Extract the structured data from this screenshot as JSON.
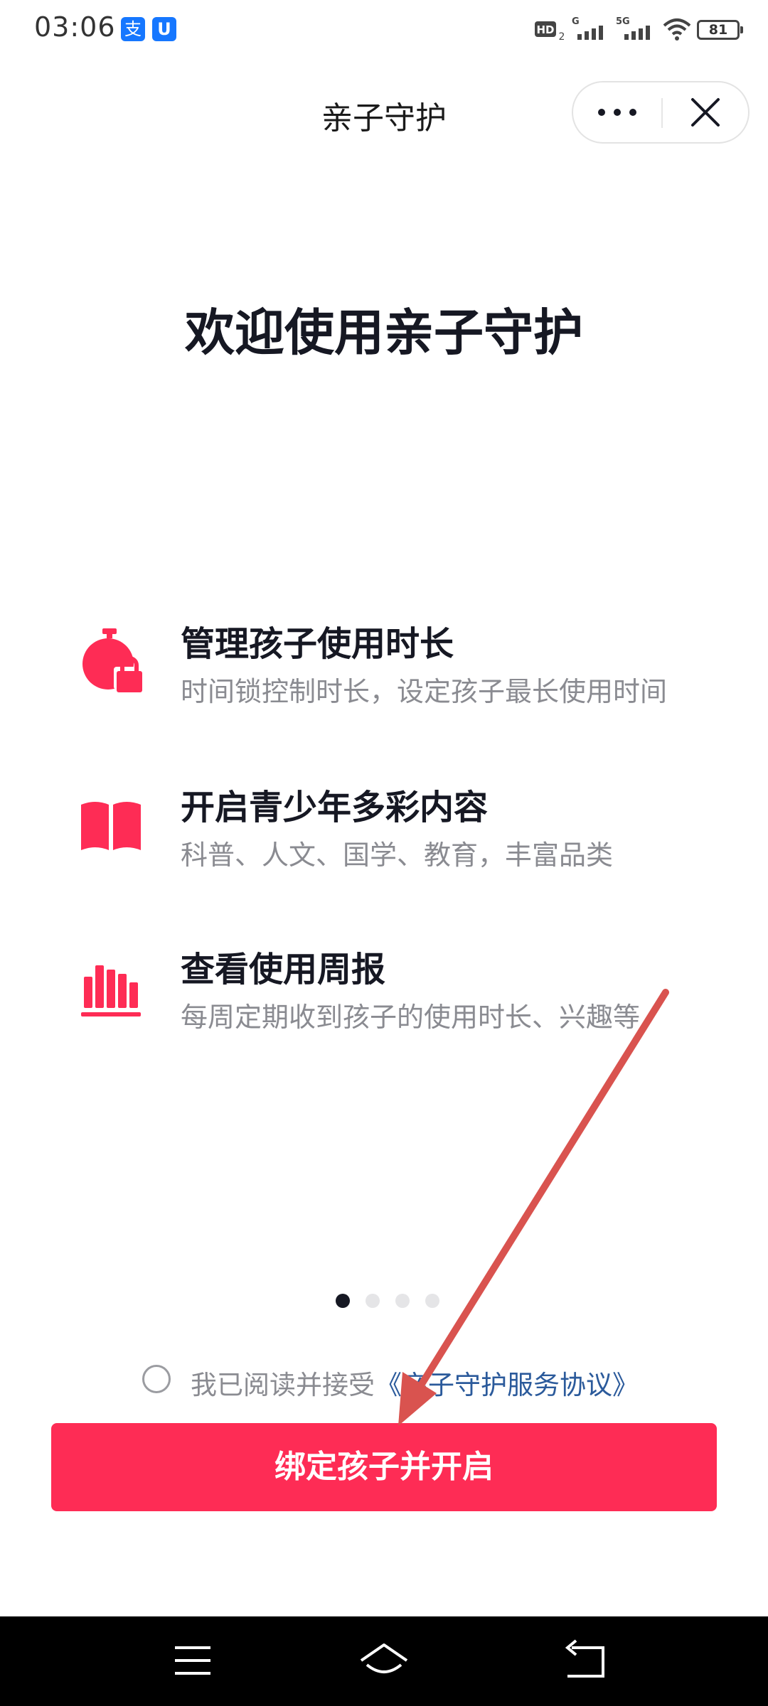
{
  "status_bar": {
    "time": "03:06",
    "app_icons": [
      "alipay-icon",
      "shield-app-icon"
    ],
    "alipay_glyph": "支",
    "shield_glyph": "U",
    "battery_level": "81",
    "network_labels": [
      "HD",
      "G",
      "5G"
    ]
  },
  "title_bar": {
    "title": "亲子守护"
  },
  "welcome": {
    "title": "欢迎使用亲子守护"
  },
  "features": [
    {
      "icon": "timer-lock-icon",
      "title": "管理孩子使用时长",
      "desc": "时间锁控制时长，设定孩子最长使用时间"
    },
    {
      "icon": "book-icon",
      "title": "开启青少年多彩内容",
      "desc": "科普、人文、国学、教育，丰富品类"
    },
    {
      "icon": "bar-chart-icon",
      "title": "查看使用周报",
      "desc": "每周定期收到孩子的使用时长、兴趣等"
    }
  ],
  "pager": {
    "count": 4,
    "active_index": 0
  },
  "agreement": {
    "checked": false,
    "text": "我已阅读并接受",
    "link": "《亲子守护服务协议》"
  },
  "actions": {
    "primary_label": "绑定孩子并开启"
  },
  "colors": {
    "accent": "#fe2c55",
    "title_text": "#161823",
    "secondary_text": "#8a8b91",
    "link": "#2b5a9b",
    "annotation_arrow": "#d9534f"
  }
}
